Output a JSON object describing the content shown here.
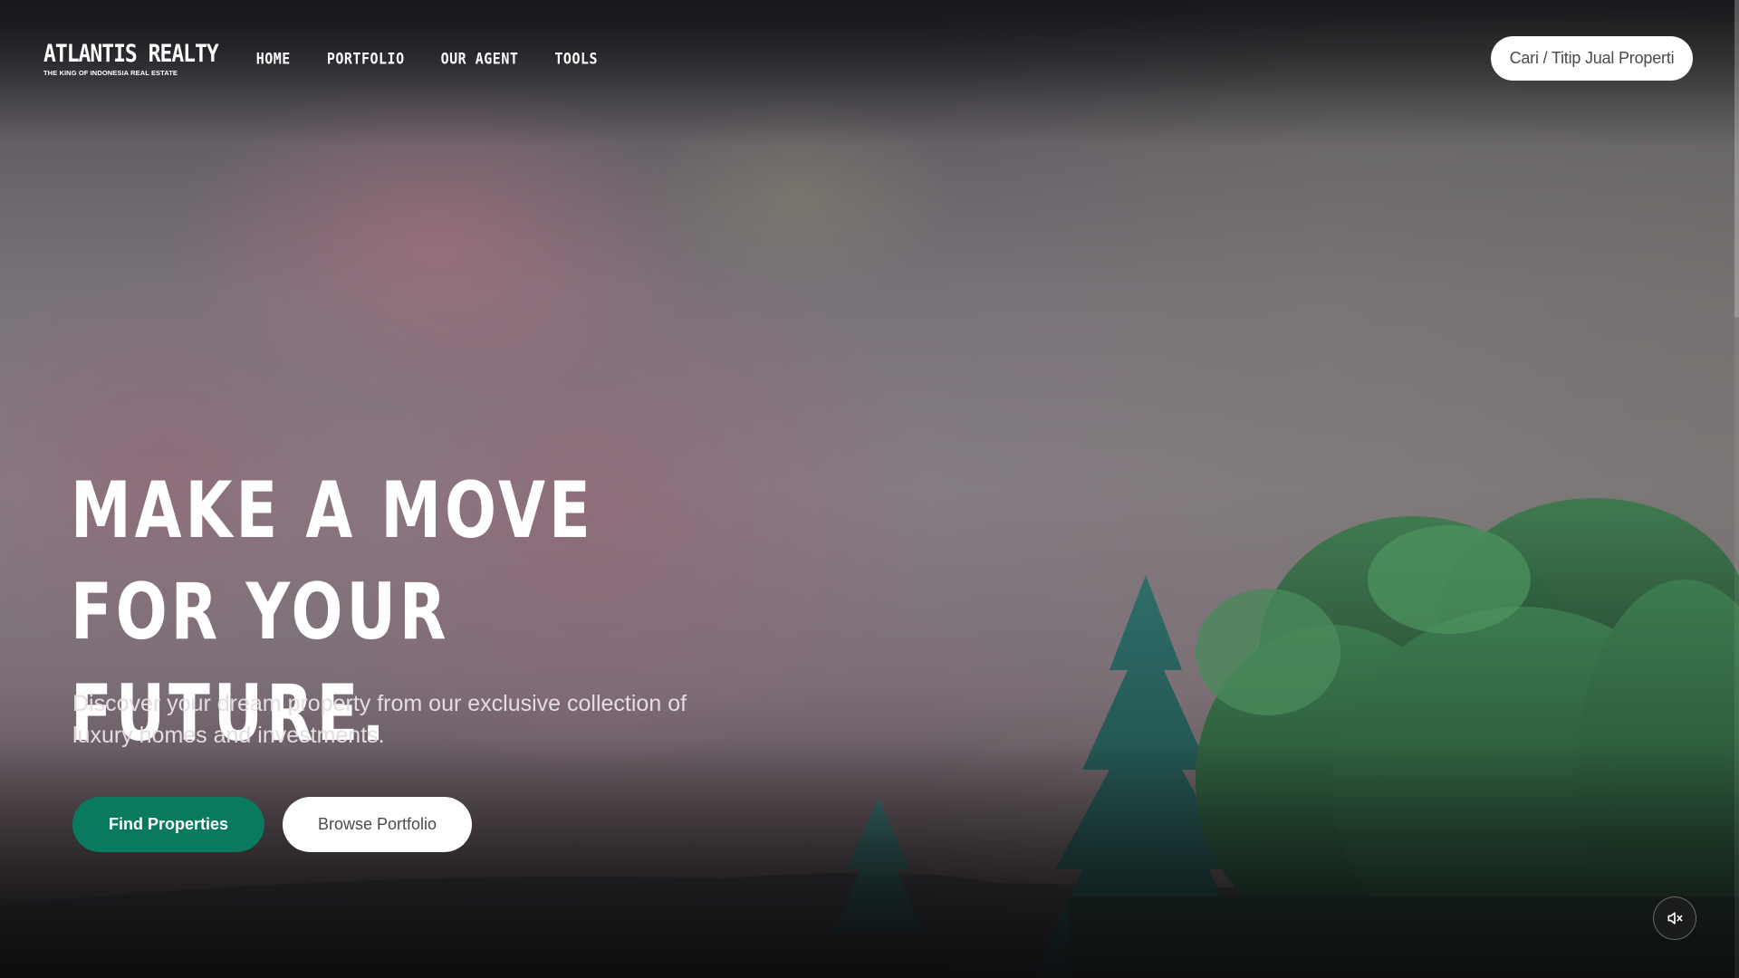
{
  "brand": {
    "name": "ATLANTIS REALTY",
    "tagline": "THE KING OF INDONESIA REAL ESTATE"
  },
  "nav": {
    "links": [
      {
        "label": "HOME"
      },
      {
        "label": "PORTFOLIO"
      },
      {
        "label": "OUR AGENT"
      },
      {
        "label": "TOOLS"
      }
    ],
    "cta_label": "Cari / Titip Jual Properti"
  },
  "hero": {
    "title_line1": "MAKE A MOVE FOR YOUR",
    "title_line2": "FUTURE.",
    "subtitle": "Discover your dream property from our exclusive collection of luxury homes and investments.",
    "primary_button": "Find Properties",
    "secondary_button": "Browse Portfolio"
  },
  "controls": {
    "mute_icon": "speaker-muted-icon"
  },
  "colors": {
    "accent": "#0a7a5e",
    "text_on_dark": "#ffffff",
    "button_light": "#ffffff"
  }
}
